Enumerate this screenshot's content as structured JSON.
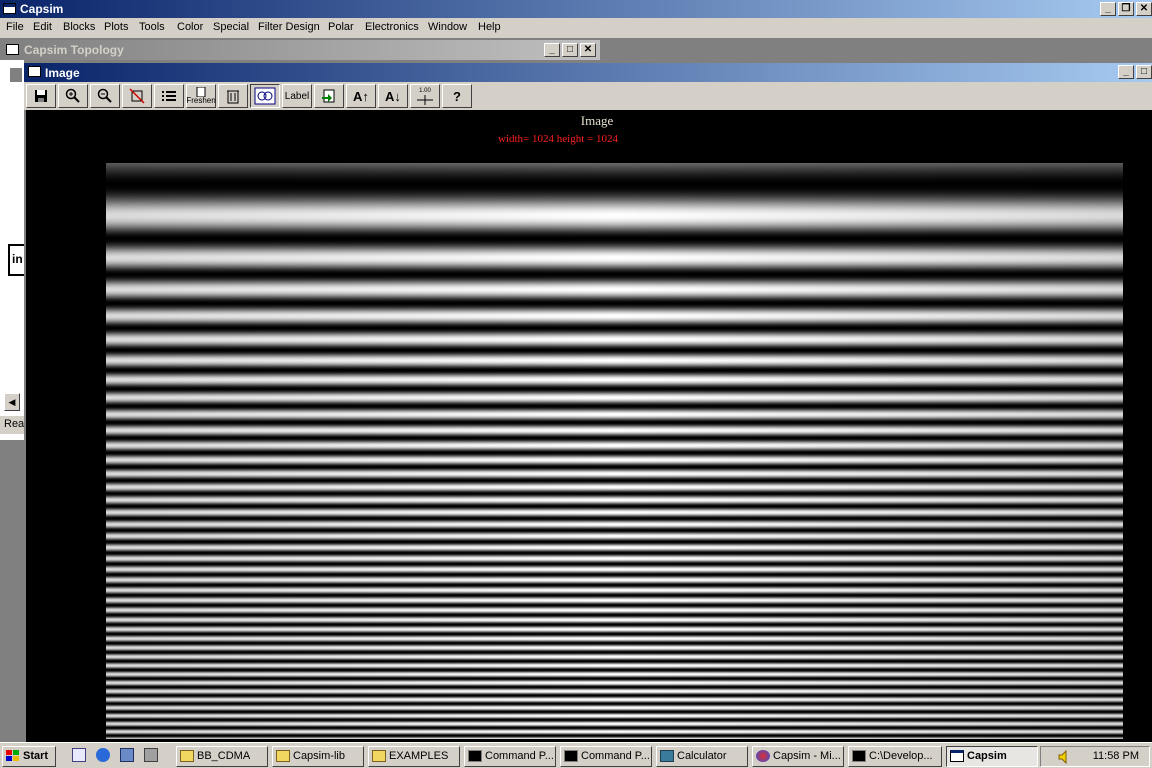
{
  "app": {
    "title": "Capsim"
  },
  "menu": [
    "File",
    "Edit",
    "Blocks",
    "Plots",
    "Tools",
    "Color",
    "Special",
    "Filter Design",
    "Polar",
    "Electronics",
    "Window",
    "Help"
  ],
  "topology": {
    "title": "Capsim Topology",
    "partial_text": "in",
    "status": "Rea"
  },
  "image_window": {
    "title": "Image",
    "toolbar": {
      "refresh_label": "Freshen",
      "label_btn": "Label",
      "a_up": "A↑",
      "a_down": "A↓",
      "tick_label": "1.00",
      "help": "?"
    },
    "plot_title": "Image",
    "plot_subtitle": "width= 1024 height = 1024"
  },
  "taskbar": {
    "start": "Start",
    "tasks": [
      "BB_CDMA",
      "Capsim-lib",
      "EXAMPLES",
      "Command P...",
      "Command P...",
      "Calculator",
      "Capsim - Mi...",
      "C:\\Develop...",
      "Capsim"
    ],
    "clock": "11:58 PM"
  },
  "colors": {
    "titlebar": "#0a246a",
    "chrome": "#d4d0c8",
    "subtitle": "#ff2020"
  }
}
